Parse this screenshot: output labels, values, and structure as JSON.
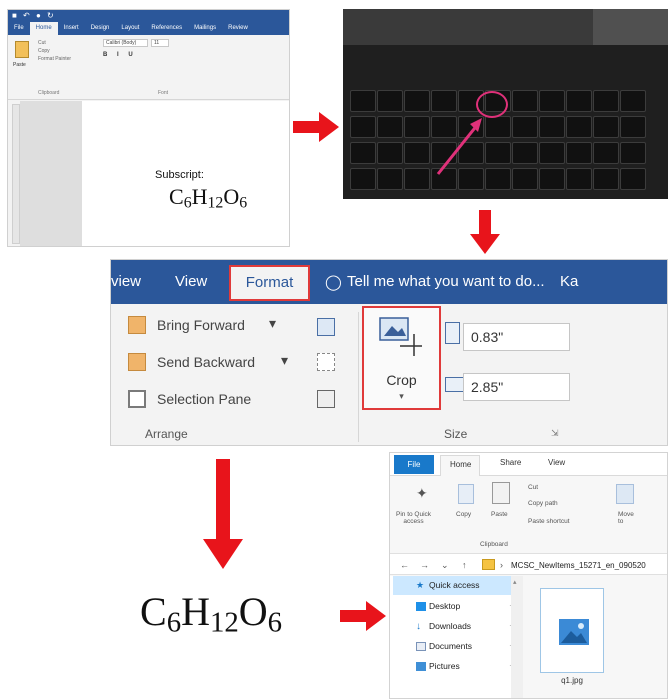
{
  "word": {
    "tabs": [
      "File",
      "Home",
      "Insert",
      "Design",
      "Layout",
      "References",
      "Mailings",
      "Review"
    ],
    "paste_label": "Paste",
    "clipboard_items": [
      "Cut",
      "Copy",
      "Format Painter"
    ],
    "font_name": "Calibri (Body)",
    "font_size": "11",
    "groups": [
      "Clipboard",
      "Font"
    ],
    "subscript_label": "Subscript:"
  },
  "keyboard_highlight": "prtsc-key",
  "format_ribbon": {
    "tabs_left": [
      "view",
      "View"
    ],
    "active_tab": "Format",
    "tell_me": "Tell me what you want to do...",
    "user": "Ka",
    "arrange_items": [
      "Bring Forward",
      "Send Backward",
      "Selection Pane"
    ],
    "crop_label": "Crop",
    "height_value": "0.83\"",
    "width_value": "2.85\"",
    "groups": [
      "Arrange",
      "Size"
    ]
  },
  "explorer": {
    "tabs": [
      "File",
      "Home",
      "Share",
      "View"
    ],
    "ribbon": {
      "pin": "Pin to Quick\naccess",
      "copy": "Copy",
      "paste": "Paste",
      "cut": "Cut",
      "copy_path": "Copy path",
      "paste_shortcut": "Paste shortcut",
      "move_to": "Move\nto",
      "clipboard_group": "Clipboard"
    },
    "address": "MCSC_NewItems_15271_en_090520",
    "nav": [
      {
        "label": "Quick access",
        "icon": "star-icon"
      },
      {
        "label": "Desktop",
        "icon": "desktop-icon"
      },
      {
        "label": "Downloads",
        "icon": "download-icon"
      },
      {
        "label": "Documents",
        "icon": "documents-icon"
      },
      {
        "label": "Pictures",
        "icon": "pictures-icon"
      }
    ],
    "file_name": "q1.jpg"
  },
  "colors": {
    "word_blue": "#2b579a",
    "highlight_red": "#e03a3a",
    "arrow_red": "#e8141b",
    "pink_circle": "#e0317a",
    "explorer_blue": "#1979ca"
  }
}
